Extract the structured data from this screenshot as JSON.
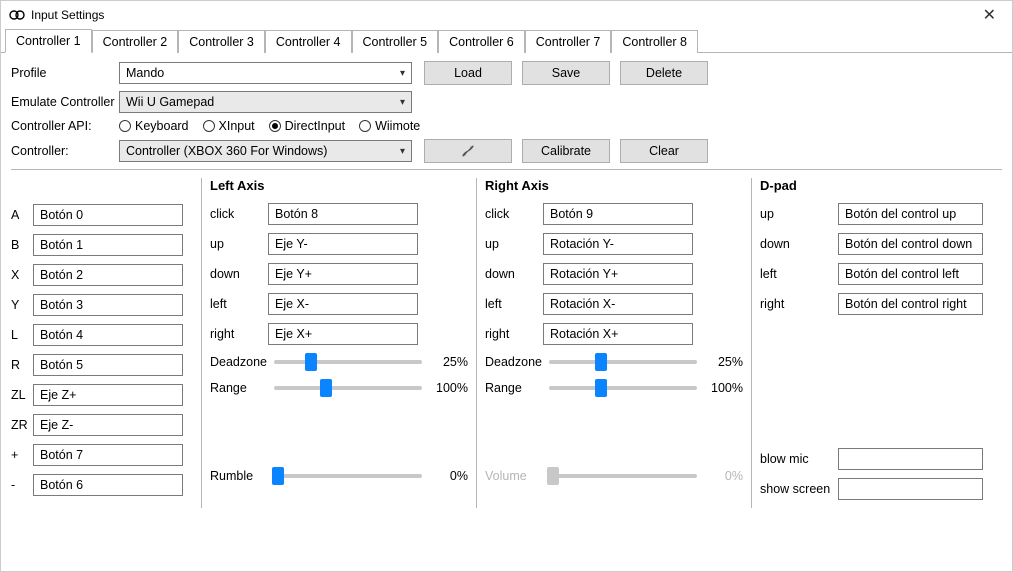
{
  "window": {
    "title": "Input Settings"
  },
  "tabs": [
    "Controller 1",
    "Controller 2",
    "Controller 3",
    "Controller 4",
    "Controller 5",
    "Controller 6",
    "Controller 7",
    "Controller 8"
  ],
  "profile": {
    "label": "Profile",
    "value": "Mando",
    "load": "Load",
    "save": "Save",
    "delete": "Delete"
  },
  "emulate": {
    "label": "Emulate Controller",
    "value": "Wii U Gamepad"
  },
  "api": {
    "label": "Controller API:",
    "options": [
      "Keyboard",
      "XInput",
      "DirectInput",
      "Wiimote"
    ],
    "selected": "DirectInput"
  },
  "controller": {
    "label": "Controller:",
    "value": "Controller (XBOX 360 For Windows)",
    "refresh_icon": "refresh",
    "calibrate": "Calibrate",
    "clear": "Clear"
  },
  "buttons": {
    "A": "Botón 0",
    "B": "Botón 1",
    "X": "Botón 2",
    "Y": "Botón 3",
    "L": "Botón 4",
    "R": "Botón 5",
    "ZL": "Eje Z+",
    "ZR": "Eje Z-",
    "+": "Botón 7",
    "-": "Botón 6"
  },
  "leftaxis": {
    "title": "Left Axis",
    "click": {
      "label": "click",
      "value": "Botón 8"
    },
    "up": {
      "label": "up",
      "value": "Eje Y-"
    },
    "down": {
      "label": "down",
      "value": "Eje Y+"
    },
    "left": {
      "label": "left",
      "value": "Eje X-"
    },
    "right": {
      "label": "right",
      "value": "Eje X+"
    },
    "deadzone": {
      "label": "Deadzone",
      "pct": "25%",
      "pos": 25
    },
    "range": {
      "label": "Range",
      "pct": "100%",
      "pos": 35
    },
    "rumble": {
      "label": "Rumble",
      "pct": "0%",
      "pos": 3
    }
  },
  "rightaxis": {
    "title": "Right Axis",
    "click": {
      "label": "click",
      "value": "Botón 9"
    },
    "up": {
      "label": "up",
      "value": "Rotación Y-"
    },
    "down": {
      "label": "down",
      "value": "Rotación Y+"
    },
    "left": {
      "label": "left",
      "value": "Rotación X-"
    },
    "right": {
      "label": "right",
      "value": "Rotación X+"
    },
    "deadzone": {
      "label": "Deadzone",
      "pct": "25%",
      "pos": 35
    },
    "range": {
      "label": "Range",
      "pct": "100%",
      "pos": 35
    },
    "volume": {
      "label": "Volume",
      "pct": "0%",
      "pos": 3
    }
  },
  "dpad": {
    "title": "D-pad",
    "up": {
      "label": "up",
      "value": "Botón del control up"
    },
    "down": {
      "label": "down",
      "value": "Botón del control down"
    },
    "left": {
      "label": "left",
      "value": "Botón del control left"
    },
    "right": {
      "label": "right",
      "value": "Botón del control right"
    },
    "blowmic": {
      "label": "blow mic",
      "value": ""
    },
    "showscreen": {
      "label": "show screen",
      "value": ""
    }
  }
}
